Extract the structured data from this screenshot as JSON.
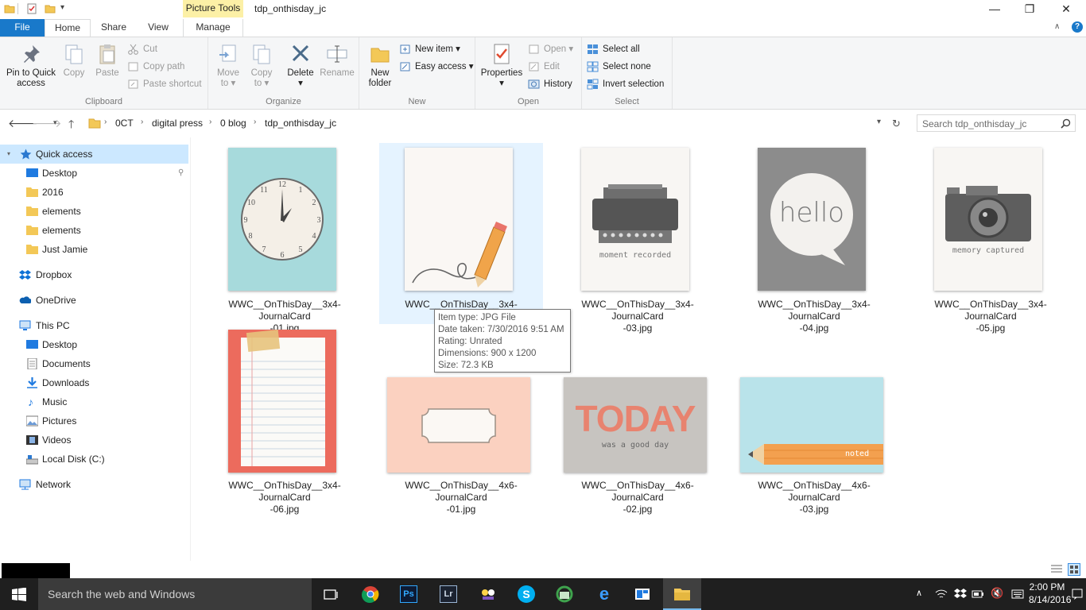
{
  "window": {
    "contextual_tab": "Picture Tools",
    "title": "tdp_onthisday_jc",
    "minimize": "—",
    "maximize": "❐",
    "close": "✕"
  },
  "tabs": {
    "file": "File",
    "home": "Home",
    "share": "Share",
    "view": "View",
    "manage": "Manage"
  },
  "ribbon": {
    "clipboard": {
      "label": "Clipboard",
      "pin_line1": "Pin to Quick",
      "pin_line2": "access",
      "copy": "Copy",
      "paste": "Paste",
      "cut": "Cut",
      "copy_path": "Copy path",
      "paste_shortcut": "Paste shortcut"
    },
    "organize": {
      "label": "Organize",
      "move_line1": "Move",
      "move_line2": "to",
      "copy_line1": "Copy",
      "copy_line2": "to",
      "delete": "Delete",
      "rename": "Rename"
    },
    "new": {
      "label": "New",
      "new_folder_line1": "New",
      "new_folder_line2": "folder",
      "new_item": "New item",
      "easy_access": "Easy access"
    },
    "open": {
      "label": "Open",
      "properties": "Properties",
      "open": "Open",
      "edit": "Edit",
      "history": "History"
    },
    "select": {
      "label": "Select",
      "select_all": "Select all",
      "select_none": "Select none",
      "invert": "Invert selection"
    }
  },
  "address": {
    "crumbs": [
      "0CT",
      "digital press",
      "0 blog",
      "tdp_onthisday_jc"
    ],
    "search_placeholder": "Search tdp_onthisday_jc"
  },
  "nav": {
    "quick_access": "Quick access",
    "desktop": "Desktop",
    "y2016": "2016",
    "elements1": "elements",
    "elements2": "elements",
    "just_jamie": "Just Jamie",
    "dropbox": "Dropbox",
    "onedrive": "OneDrive",
    "this_pc": "This PC",
    "pc_desktop": "Desktop",
    "documents": "Documents",
    "downloads": "Downloads",
    "music": "Music",
    "pictures": "Pictures",
    "videos": "Videos",
    "local_disk": "Local Disk (C:)",
    "network": "Network"
  },
  "files": [
    {
      "line1": "WWC__OnThisDay__3x4-JournalCard",
      "line2": "-01.jpg"
    },
    {
      "line1": "WWC__OnThisDay__3x4-JournalCard",
      "line2": ""
    },
    {
      "line1": "WWC__OnThisDay__3x4-JournalCard",
      "line2": "-03.jpg"
    },
    {
      "line1": "WWC__OnThisDay__3x4-JournalCard",
      "line2": "-04.jpg"
    },
    {
      "line1": "WWC__OnThisDay__3x4-JournalCard",
      "line2": "-05.jpg"
    },
    {
      "line1": "WWC__OnThisDay__3x4-JournalCard",
      "line2": "-06.jpg"
    },
    {
      "line1": "WWC__OnThisDay__4x6-JournalCard",
      "line2": "-01.jpg"
    },
    {
      "line1": "WWC__OnThisDay__4x6-JournalCard",
      "line2": "-02.jpg"
    },
    {
      "line1": "WWC__OnThisDay__4x6-JournalCard",
      "line2": "-03.jpg"
    }
  ],
  "thumb_text": {
    "moment": "moment recorded",
    "hello": "hello",
    "memory": "memory captured",
    "today": "TODAY",
    "good_day": "was a good day",
    "noted": "noted"
  },
  "tooltip": {
    "type": "Item type: JPG File",
    "date": "Date taken: 7/30/2016 9:51 AM",
    "rating": "Rating: Unrated",
    "dims": "Dimensions: 900 x 1200",
    "size": "Size: 72.3 KB"
  },
  "taskbar": {
    "search": "Search the web and Windows",
    "time": "2:00 PM",
    "date": "8/14/2016"
  },
  "colors": {
    "file_tab": "#1979ca",
    "selection": "#e5f3ff",
    "taskbar": "#1f1f1f",
    "contextual": "#fcf0a6"
  }
}
